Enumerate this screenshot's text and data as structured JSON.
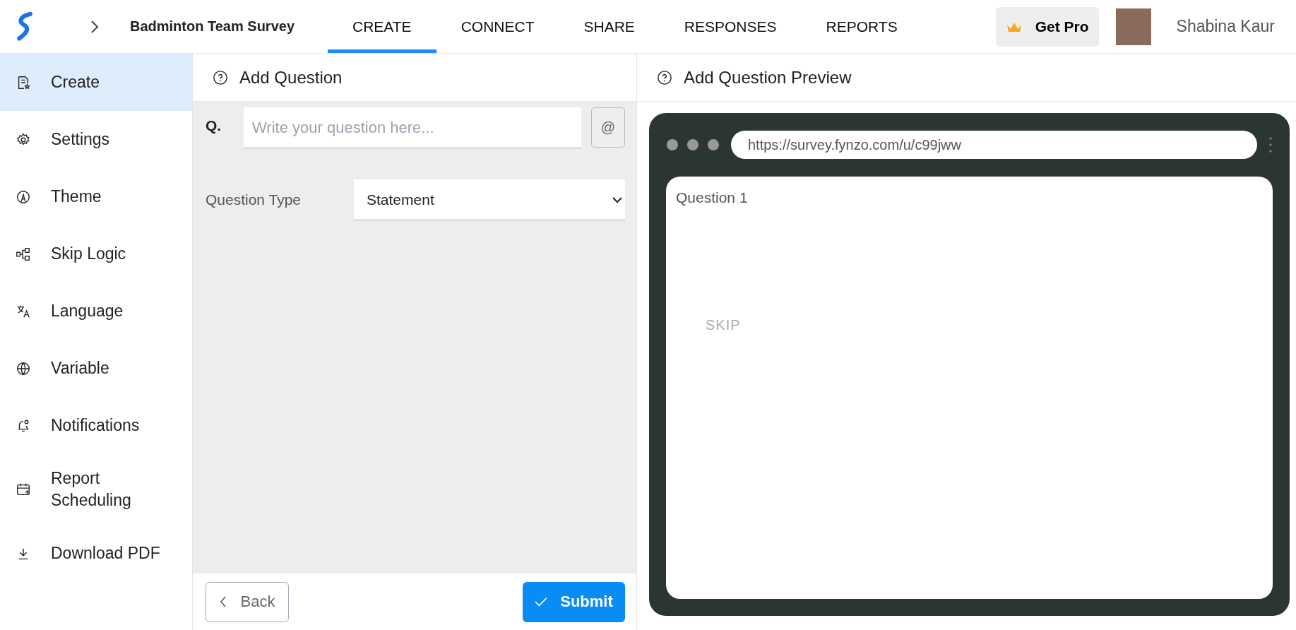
{
  "header": {
    "survey_title": "Badminton Team Survey",
    "get_pro": "Get Pro",
    "user_name": "Shabina Kaur"
  },
  "tabs": [
    {
      "label": "CREATE",
      "selected": true
    },
    {
      "label": "CONNECT",
      "selected": false
    },
    {
      "label": "SHARE",
      "selected": false
    },
    {
      "label": "RESPONSES",
      "selected": false
    },
    {
      "label": "REPORTS",
      "selected": false
    }
  ],
  "sidebar": {
    "items": [
      {
        "label": "Create",
        "selected": true
      },
      {
        "label": "Settings",
        "selected": false
      },
      {
        "label": "Theme",
        "selected": false
      },
      {
        "label": "Skip Logic",
        "selected": false
      },
      {
        "label": "Language",
        "selected": false
      },
      {
        "label": "Variable",
        "selected": false
      },
      {
        "label": "Notifications",
        "selected": false
      },
      {
        "label": "Report Scheduling",
        "selected": false
      },
      {
        "label": "Download PDF",
        "selected": false
      }
    ]
  },
  "editor": {
    "title": "Add Question",
    "q_label": "Q.",
    "question": {
      "placeholder": "Write your question here..."
    },
    "mention_button": "@",
    "type_label": "Question Type",
    "type_value": "Statement",
    "back_button": "Back",
    "submit_button": "Submit"
  },
  "preview": {
    "title": "Add Question Preview",
    "url": "https://survey.fynzo.com/u/c99jww",
    "question_label": "Question 1",
    "skip_button": "SKIP"
  }
}
